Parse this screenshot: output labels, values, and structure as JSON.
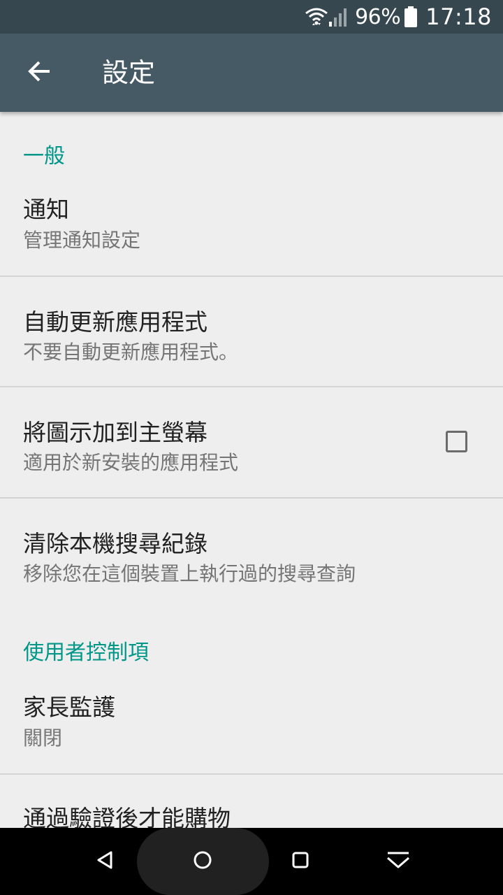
{
  "status_bar": {
    "battery_percent": "96%",
    "time": "17:18"
  },
  "app_bar": {
    "title": "設定"
  },
  "sections": {
    "general": {
      "header": "一般",
      "notifications_title": "通知",
      "notifications_subtitle": "管理通知設定",
      "auto_update_title": "自動更新應用程式",
      "auto_update_subtitle": "不要自動更新應用程式。",
      "add_icon_title": "將圖示加到主螢幕",
      "add_icon_subtitle": "適用於新安裝的應用程式",
      "add_icon_checked": false,
      "clear_history_title": "清除本機搜尋紀錄",
      "clear_history_subtitle": "移除您在這個裝置上執行過的搜尋查詢"
    },
    "user_controls": {
      "header": "使用者控制項",
      "parental_title": "家長監護",
      "parental_subtitle": "關閉",
      "auth_purchase_title": "通過驗證後才能購物"
    }
  },
  "icons": {
    "back": "arrow-back-icon",
    "wifi": "wifi-icon",
    "signal": "cell-signal-icon",
    "battery": "battery-icon",
    "nav_back": "nav-back-icon",
    "nav_home": "nav-home-icon",
    "nav_recents": "nav-recents-icon",
    "nav_hide": "nav-hide-icon"
  },
  "colors": {
    "status_bar": "#37474f",
    "app_bar": "#455a64",
    "section_header": "#009688",
    "background": "#eeeeee"
  }
}
